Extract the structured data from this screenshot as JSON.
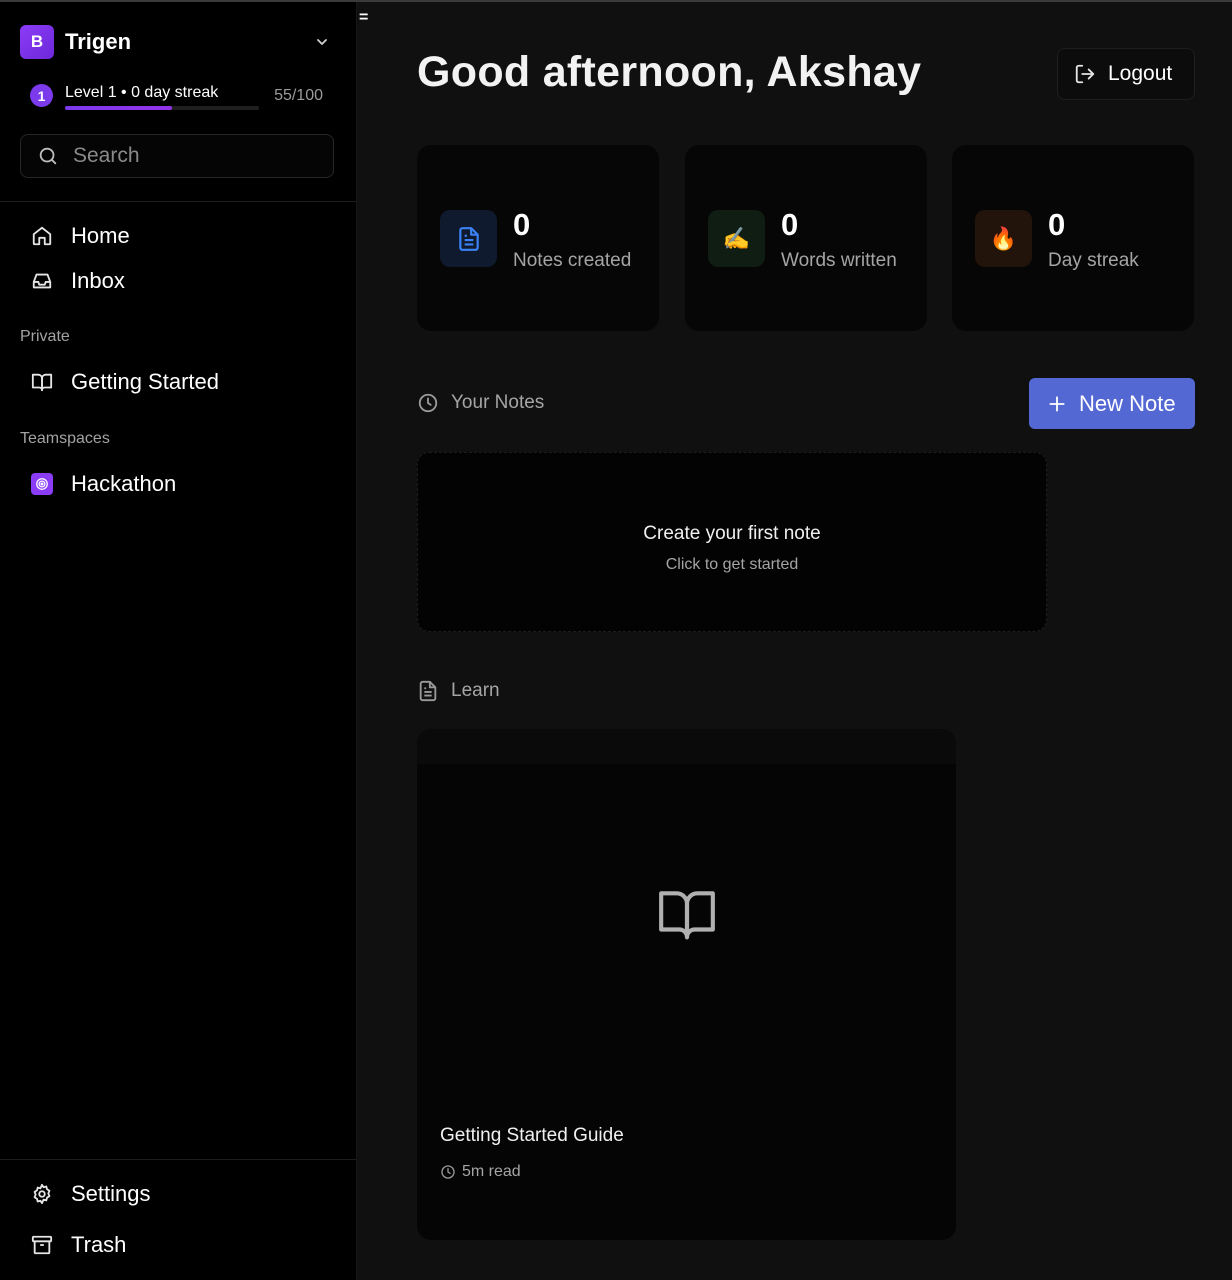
{
  "sidebar": {
    "workspace": {
      "initial": "B",
      "name": "Trigen"
    },
    "level": {
      "badge": "1",
      "text": "Level 1 • 0 day streak",
      "score": "55/100",
      "progress": 0.55
    },
    "search": {
      "placeholder": "Search"
    },
    "nav": [
      {
        "label": "Home",
        "icon": "home-icon"
      },
      {
        "label": "Inbox",
        "icon": "inbox-icon"
      }
    ],
    "private_label": "Private",
    "private_items": [
      {
        "label": "Getting Started",
        "icon": "book-icon"
      }
    ],
    "teamspaces_label": "Teamspaces",
    "teamspace_items": [
      {
        "label": "Hackathon",
        "icon": "target-icon"
      }
    ],
    "bottom": [
      {
        "label": "Settings",
        "icon": "gear-icon"
      },
      {
        "label": "Trash",
        "icon": "archive-icon"
      }
    ]
  },
  "main": {
    "menu_glyph": "=",
    "greeting": "Good afternoon, Akshay",
    "logout_label": "Logout",
    "stats": [
      {
        "value": "0",
        "label": "Notes created",
        "icon": "file-text-icon",
        "icon_color": "#3b82f6",
        "icon_bg": "#0f1a2e"
      },
      {
        "value": "0",
        "label": "Words written",
        "icon": "writing-hand-icon",
        "glyph": "✍️",
        "icon_bg": "#0f1d12"
      },
      {
        "value": "0",
        "label": "Day streak",
        "icon": "fire-icon",
        "glyph": "🔥",
        "icon_bg": "#22140a"
      }
    ],
    "notes_section": {
      "label": "Your Notes",
      "new_note_label": "New Note"
    },
    "empty_note": {
      "title": "Create your first note",
      "subtitle": "Click to get started"
    },
    "learn_section": {
      "label": "Learn"
    },
    "guide": {
      "title": "Getting Started Guide",
      "meta": "5m read"
    }
  },
  "colors": {
    "accent": "#5468d4",
    "purple": "#8b3cf6",
    "background": "#101010",
    "sidebar": "#000000"
  }
}
